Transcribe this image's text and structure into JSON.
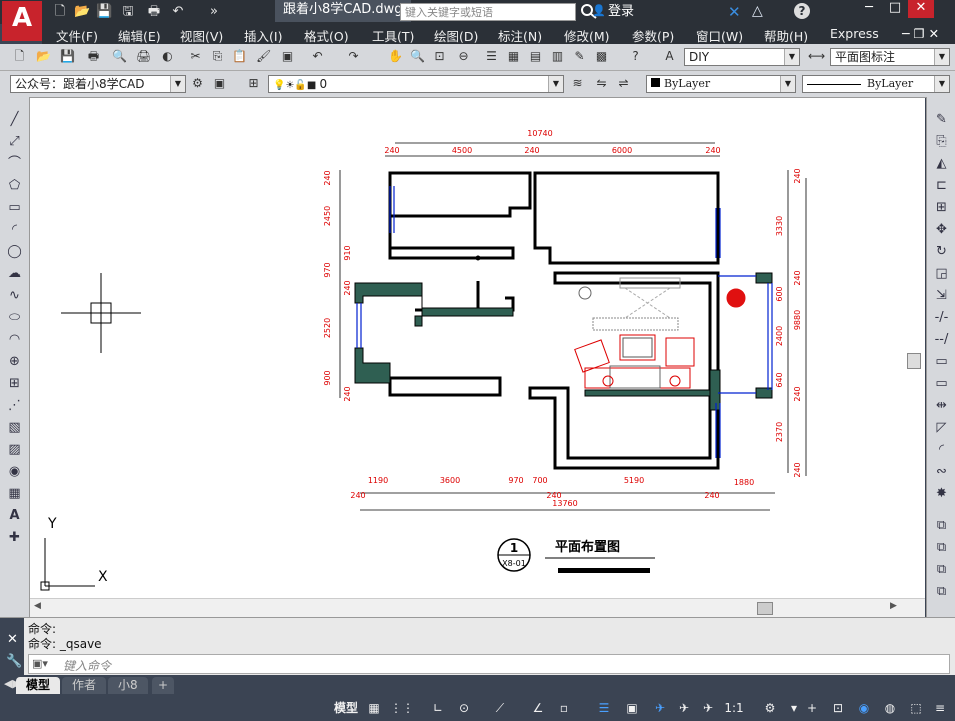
{
  "app": {
    "logo": "A",
    "doc_title": "跟着小8学CAD.dwg",
    "search_placeholder": "键入关键字或短语",
    "login": "登录"
  },
  "menu": [
    "文件(F)",
    "编辑(E)",
    "视图(V)",
    "插入(I)",
    "格式(O)",
    "工具(T)",
    "绘图(D)",
    "标注(N)",
    "修改(M)",
    "参数(P)",
    "窗口(W)",
    "帮助(H)",
    "Express"
  ],
  "toolbar1": {
    "style_dropdown": "DIY",
    "dim_style_dropdown": "平面图标注"
  },
  "toolbar2": {
    "workspace_dropdown": "公众号：跟着小8学CAD",
    "layer_dropdown": "0",
    "color_dropdown": "ByLayer",
    "linetype_dropdown": "ByLayer"
  },
  "drawing": {
    "dims_top": [
      "10740",
      "240",
      "4500",
      "240",
      "6000",
      "240"
    ],
    "dims_bottom": [
      "1190",
      "3600",
      "970",
      "700",
      "5190",
      "1880",
      "240",
      "240",
      "240",
      "13760"
    ],
    "dims_left": [
      "240",
      "2450",
      "910",
      "970",
      "240",
      "2520",
      "900",
      "240"
    ],
    "dims_right": [
      "240",
      "3330",
      "240",
      "600",
      "9880",
      "2400",
      "640",
      "240",
      "2370",
      "240"
    ],
    "title": "平面布置图",
    "callout_num": "1",
    "callout_sheet": "X8-01",
    "ucs_x": "X",
    "ucs_y": "Y"
  },
  "command": {
    "history": [
      "命令:",
      "命令:  _qsave"
    ],
    "prompt_placeholder": "键入命令"
  },
  "tabs": [
    "模型",
    "作者",
    "小8"
  ],
  "status": {
    "model_label": "模型",
    "scale": "1:1"
  }
}
